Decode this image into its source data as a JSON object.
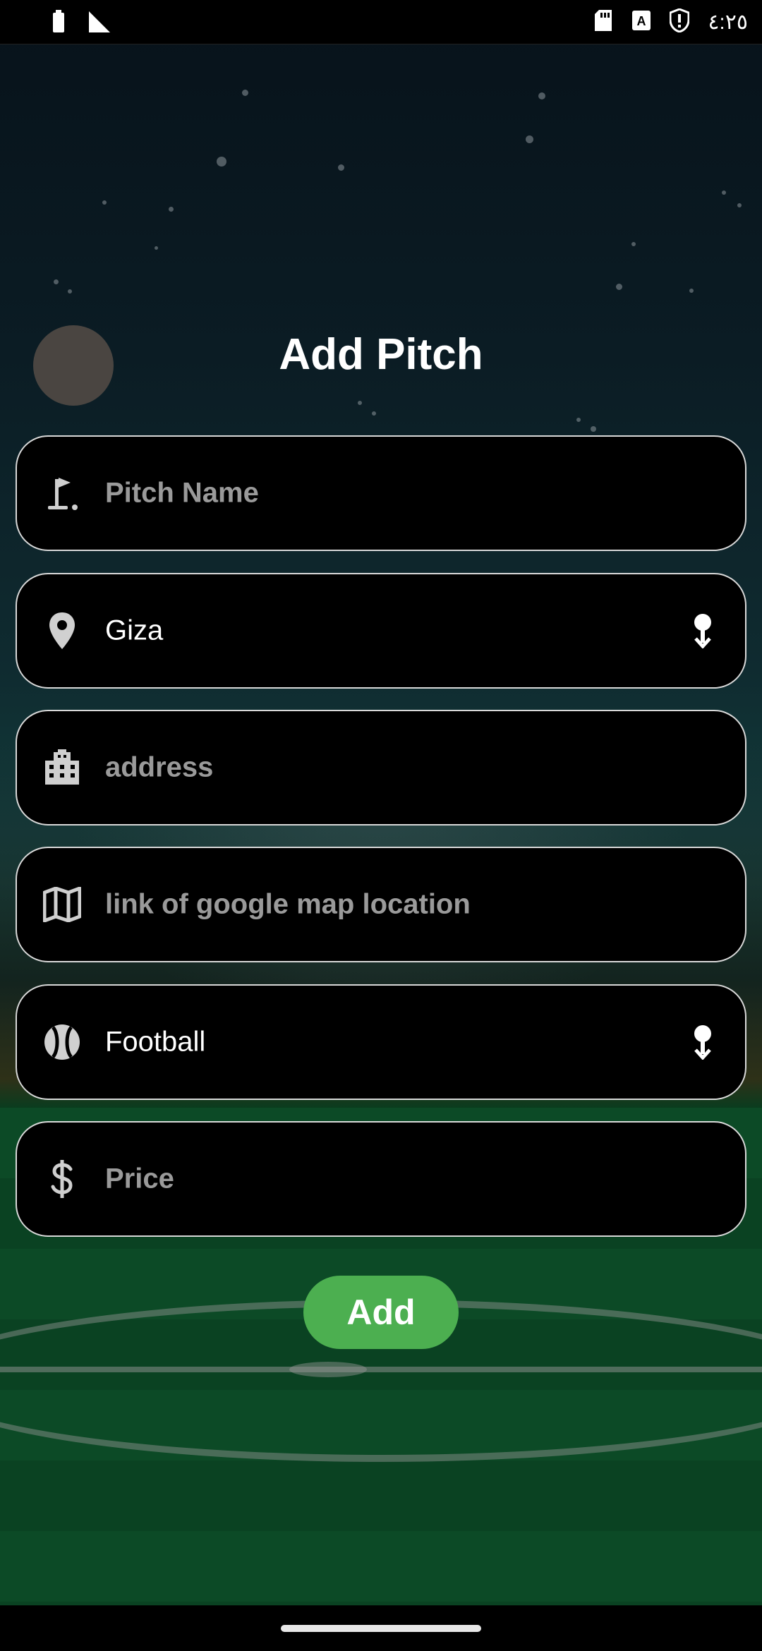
{
  "status_bar": {
    "time": "٤:٢٥",
    "left_icons": [
      "battery-icon",
      "signal-icon"
    ],
    "right_icons": [
      "sd-card-icon",
      "keyboard-a-icon",
      "shield-icon"
    ]
  },
  "header": {
    "title": "Add Pitch",
    "back_icon": "back-circle"
  },
  "form": {
    "pitch_name": {
      "placeholder": "Pitch Name",
      "value": "",
      "icon": "golf-flag-icon"
    },
    "city": {
      "value": "Giza",
      "icon": "location-pin-icon",
      "trailing_icon": "dropdown-pin-icon"
    },
    "address": {
      "placeholder": "address",
      "value": "",
      "icon": "building-icon"
    },
    "map_link": {
      "placeholder": "link of google map location",
      "value": "",
      "icon": "map-icon"
    },
    "sport": {
      "value": "Football",
      "icon": "ball-icon",
      "trailing_icon": "dropdown-pin-icon"
    },
    "price": {
      "placeholder": "Price",
      "value": "",
      "icon": "dollar-icon"
    }
  },
  "actions": {
    "add_label": "Add"
  },
  "colors": {
    "accent": "#4caf50",
    "field_border": "#d9d9d9",
    "placeholder": "#9a9a9a"
  }
}
